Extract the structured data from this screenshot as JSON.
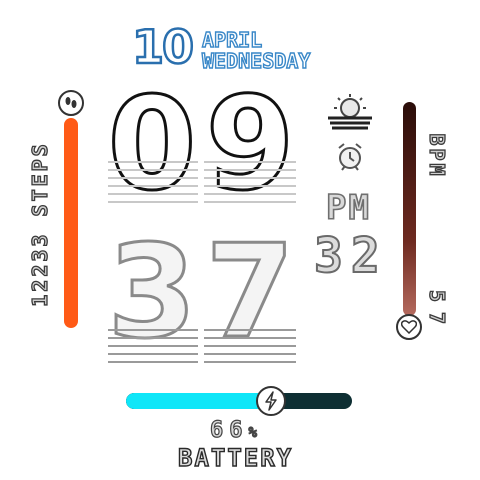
{
  "date": {
    "day": "10",
    "month": "APRIL",
    "weekday": "WEDNESDAY"
  },
  "time": {
    "hour_tens": "0",
    "hour_ones": "9",
    "minute_tens": "3",
    "minute_ones": "7",
    "ampm": "PM",
    "seconds": "32"
  },
  "steps": {
    "value": "12233",
    "label": "STEPS",
    "progress": 0.95,
    "color": "#ff5a16"
  },
  "heart_rate": {
    "label": "BPM",
    "value": "57",
    "level": 0.1
  },
  "battery": {
    "percent": "66",
    "percent_sign": "%",
    "label": "BATTERY",
    "level": 0.66,
    "color": "#0fe6f8"
  },
  "icons": {
    "weather": "partly-cloudy-icon",
    "alarm": "alarm-clock-icon",
    "steps": "footprints-icon",
    "heart": "heart-icon",
    "charge": "lightning-icon"
  }
}
